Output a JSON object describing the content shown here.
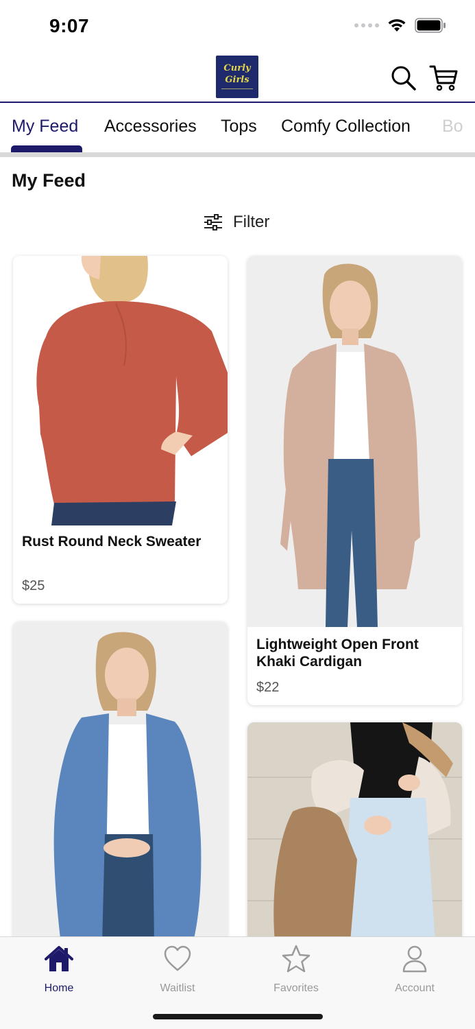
{
  "status": {
    "time": "9:07"
  },
  "header": {
    "logo_text": "Curly\nGirls",
    "logo_alt": "Curly Girls logo"
  },
  "tabs": [
    {
      "label": "My Feed",
      "active": true
    },
    {
      "label": "Accessories"
    },
    {
      "label": "Tops"
    },
    {
      "label": "Comfy Collection"
    },
    {
      "label": "Bo"
    }
  ],
  "page": {
    "title": "My Feed"
  },
  "filter": {
    "label": "Filter"
  },
  "products": [
    {
      "title": "Rust Round Neck Sweater",
      "price": "$25"
    },
    {
      "title": "Lightweight Open Front Khaki Cardigan",
      "price": "$22"
    },
    {
      "title": "",
      "price": ""
    },
    {
      "title": "",
      "price": ""
    }
  ],
  "tabbar": [
    {
      "label": "Home",
      "active": true
    },
    {
      "label": "Waitlist"
    },
    {
      "label": "Favorites"
    },
    {
      "label": "Account"
    }
  ],
  "colors": {
    "brand": "#1d1a6a",
    "inactive": "#999999",
    "divider": "#d9d9d9"
  }
}
